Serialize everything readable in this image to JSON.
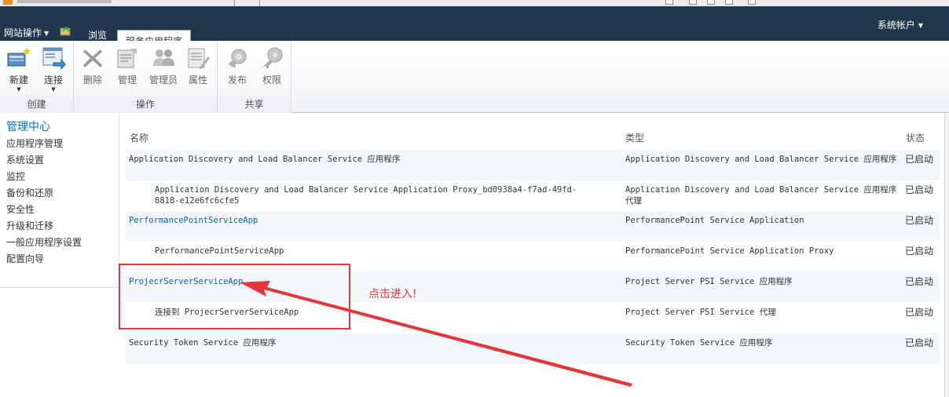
{
  "topbar": {
    "site_actions": "网站操作",
    "browse_tab": "浏览",
    "active_tab": "服务应用程序",
    "account": "系统帐户"
  },
  "ribbon": {
    "groups": [
      {
        "label": "创建",
        "buttons": [
          {
            "label": "新建"
          },
          {
            "label": "连接"
          }
        ]
      },
      {
        "label": "操作",
        "buttons": [
          {
            "label": "删除"
          },
          {
            "label": "管理"
          },
          {
            "label": "管理员"
          },
          {
            "label": "属性"
          }
        ]
      },
      {
        "label": "共享",
        "buttons": [
          {
            "label": "发布"
          },
          {
            "label": "权限"
          }
        ]
      }
    ]
  },
  "quick_launch": {
    "heading": "管理中心",
    "items": [
      "应用程序管理",
      "系统设置",
      "监控",
      "备份和还原",
      "安全性",
      "升级和迁移",
      "一般应用程序设置",
      "配置向导"
    ]
  },
  "table": {
    "headers": {
      "name": "名称",
      "type": "类型",
      "status": "状态"
    },
    "rows": [
      {
        "name": "Application Discovery and Load Balancer Service 应用程序",
        "type": "Application Discovery and Load Balancer Service 应用程序",
        "status": "已启动"
      },
      {
        "name": "Application Discovery and Load Balancer Service Application Proxy_bd0938a4-f7ad-49fd-8818-e12e6fc6cfe5",
        "type": "Application Discovery and Load Balancer Service 应用程序代理",
        "status": "已启动"
      },
      {
        "name": "PerformancePointServiceApp",
        "type": "PerformancePoint Service Application",
        "status": "已启动"
      },
      {
        "name": "PerformancePointServiceApp",
        "type": "PerformancePoint Service Application Proxy",
        "status": "已启动"
      },
      {
        "name": "ProjecrServerServiceApp",
        "type": "Project Server PSI Service 应用程序",
        "status": "已启动"
      },
      {
        "name": "连接到 ProjecrServerServiceApp",
        "type": "Project Server PSI Service 代理",
        "status": "已启动"
      },
      {
        "name": "Security Token Service 应用程序",
        "type": "Security Token Service 应用程序",
        "status": "已启动"
      }
    ]
  },
  "annotation": {
    "text": "点击进入!",
    "color": "#e3353a"
  },
  "icons": [
    "new-icon",
    "connect-icon",
    "delete-icon",
    "manage-icon",
    "administrators-icon",
    "properties-icon",
    "publish-icon",
    "permissions-icon",
    "navigate-up-icon",
    "favicon-icon"
  ],
  "colors": {
    "topbar": "#21374c",
    "link": "#0b5ea8",
    "quicklaunch_heading": "#0072bc",
    "annotation": "#e3353a"
  }
}
